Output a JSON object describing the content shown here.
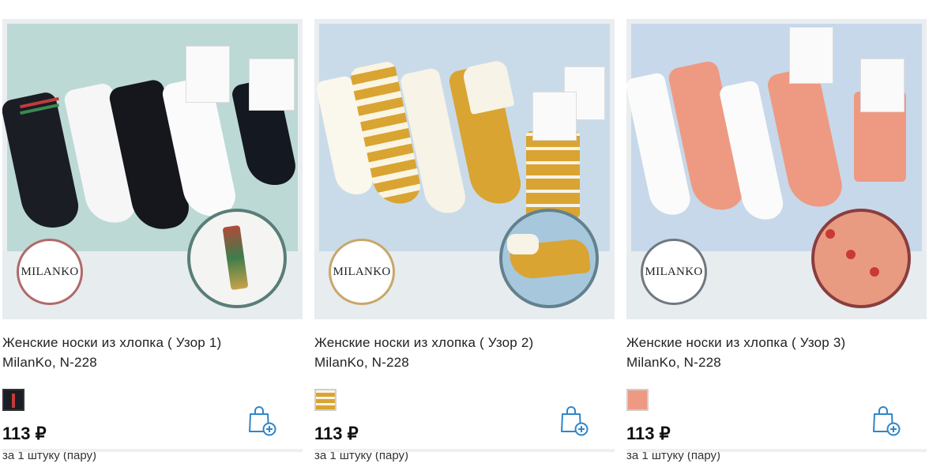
{
  "products": [
    {
      "title_line1": "Женские носки из хлопка ( Узор 1)",
      "title_line2": "MilanKo, N-228",
      "brand": "MILANKO",
      "price": "113 ₽",
      "unit": "за 1 штуку (пару)",
      "swatch_color": "#1b1d24",
      "accent_color": "#b06a6a"
    },
    {
      "title_line1": "Женские носки из хлопка ( Узор 2)",
      "title_line2": "MilanKo, N-228",
      "brand": "MILANKO",
      "price": "113 ₽",
      "unit": "за 1 штуку (пару)",
      "swatch_color": "#d9a432",
      "accent_color": "#c8a76a"
    },
    {
      "title_line1": "Женские носки из хлопка ( Узор 3)",
      "title_line2": "MilanKo, N-228",
      "brand": "MILANKO",
      "price": "113 ₽",
      "unit": "за 1 штуку (пару)",
      "swatch_color": "#ee9a82",
      "accent_color": "#6f7780"
    }
  ],
  "cart_icon_color": "#2f86c9"
}
